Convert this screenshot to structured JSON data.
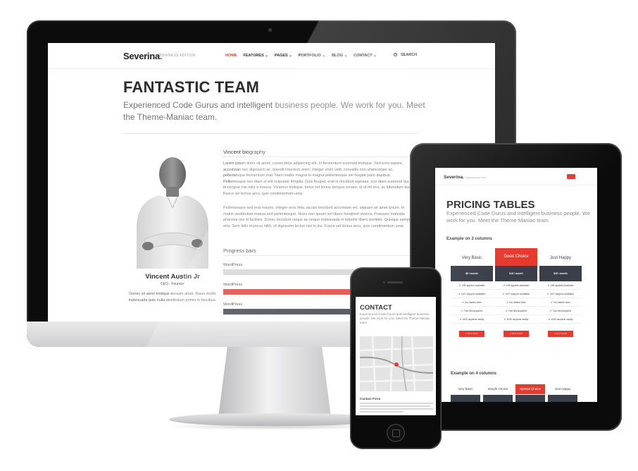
{
  "imac": {
    "logo": "Severina",
    "logo_dot": ".",
    "edition": "BUSINESS EDITION",
    "nav": [
      {
        "label": "HOME",
        "active": true
      },
      {
        "label": "FEATURES ⌄"
      },
      {
        "label": "PAGES ⌄"
      },
      {
        "label": "PORTFOLIO ⌄"
      },
      {
        "label": "BLOG ⌄"
      },
      {
        "label": "CONTACT ⌄"
      }
    ],
    "search_label": "SEARCH",
    "hero_title": "FANTASTIC TEAM",
    "hero_subtitle": "Experienced Code Gurus and intelligent business people. We work for you. Meet the Theme-Maniac team.",
    "person": {
      "name": "Vincent Austin Jr",
      "role": "CEO - Founder",
      "bio": "Donec sit amet tristique erosam amet. Risus mollis malesuada quis nulla vestibulum primis in faucibus."
    },
    "bio_heading": "Vincent biography",
    "bio_p1": "Lorem ipsum dolor sit amet, consectetur adipiscing elit. In fermentum euismod tristique. Sed eros sapien, accumsan nec dignissim ac, blandit interdum enim. Integer enim velit, convallis non ullamcorper ac, pellentesque fermentum erat. Nam mattis magna in magna pellentesque vel feugiat justo dapibus. Pellentesque nec diam et elit vulputate fringilla. Duis feugiat, erat in tincidunt egestas, orci diam euismod dui, in congue nisi odio a massa. Vivamus tristique, tortor vel lectus tempus ornare, ut id mi orci, ac bibendum dui. Fusce vel lectus arcu, quis condimentum urna.",
    "bio_p2": "Pellentesque sed erat mauris. Integer eros felis, iaculis tincidunt accumsan vel, aliquam sit amet ipsum. In mattis vestibulum massa sed pellentesque. Nunc non ipsum vel libero hendrerit viverra. Praesent molestie pharetra nisi id facilisis. Donec tincidunt neque ac neque malesuada in lobortis libero porttitor. Quisque semper etra. Sem felis rhoncus nibh, et dignissim lectus nisl in dui. Fusce vel lectus arcu, quis condimentum urna.",
    "progress_heading": "Progress bars",
    "progress": [
      {
        "label": "WordPress",
        "value": 0.86,
        "color": "#d4d4d4"
      },
      {
        "label": "WordPress",
        "value": 0.92,
        "color": "#e8392f"
      },
      {
        "label": "WordPress",
        "value": 0.8,
        "color": "#3b3f4a"
      }
    ]
  },
  "ipad": {
    "logo": "Severina.",
    "edition": "BUSINESS EDITION",
    "title": "PRICING TABLES",
    "subtitle": "Experienced Code Gurus and intelligent business people. We work for you. Meet the Theme-Maniac team.",
    "example3": "Example on 3 columns",
    "example4": "Example on 4 columns",
    "plans3": [
      {
        "name": "Very Basic",
        "price": "$5 / month",
        "features": [
          "✔ 195 applets available",
          "✔ 24/7 support available",
          "✔ No hidden fees",
          "✔ Two Mockups/Ist",
          "✔ 1000 anytime easily"
        ],
        "button": "✔ BUY NOW",
        "highlight": false
      },
      {
        "name": "Good Choice",
        "price": "$15 / month",
        "features": [
          "✔ 195 applets available",
          "✔ 24/7 support available",
          "✔ No hidden fees",
          "✔ Two Mockups/Ist",
          "✔ 1000 anytime easily"
        ],
        "button": "✔ BUY NOW",
        "highlight": true
      },
      {
        "name": "Just Happy",
        "price": "$25 / month",
        "features": [
          "✔ 195 applets available",
          "✔ 24/7 support available",
          "✔ No hidden fees",
          "✔ Two Mockups/Ist",
          "✔ 1000 anytime easily"
        ],
        "button": "✔ BUY NOW",
        "highlight": false
      }
    ],
    "plans4": [
      {
        "name": "Very Basic",
        "highlight": false
      },
      {
        "name": "Simple Choice",
        "highlight": false
      },
      {
        "name": "Special Choice",
        "highlight": true
      },
      {
        "name": "Just Happy",
        "highlight": false
      }
    ]
  },
  "iphone": {
    "title": "CONTACT",
    "subtitle": "Experienced Code Gurus and intelligent business people. We work for you. Meet the Theme-Maniac team.",
    "contact_form": "Contact Form"
  },
  "colors": {
    "accent": "#e8392f",
    "dark": "#3b3f4a",
    "bezel": "#0c0c0d"
  }
}
